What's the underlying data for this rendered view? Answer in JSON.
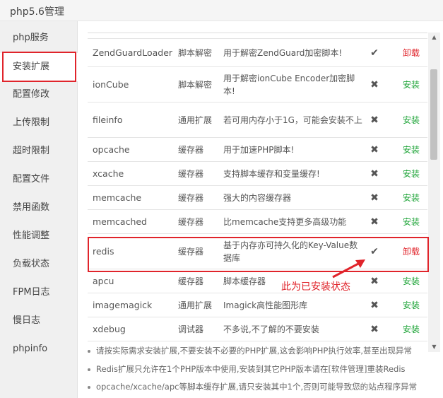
{
  "header": {
    "title": "php5.6管理"
  },
  "sidebar": {
    "items": [
      {
        "label": "php服务"
      },
      {
        "label": "安装扩展"
      },
      {
        "label": "配置修改"
      },
      {
        "label": "上传限制"
      },
      {
        "label": "超时限制"
      },
      {
        "label": "配置文件"
      },
      {
        "label": "禁用函数"
      },
      {
        "label": "性能调整"
      },
      {
        "label": "负载状态"
      },
      {
        "label": "FPM日志"
      },
      {
        "label": "慢日志"
      },
      {
        "label": "phpinfo"
      }
    ],
    "active_index": 1
  },
  "rows": [
    {
      "name": "",
      "type": "",
      "desc": "",
      "status": "",
      "op": ""
    },
    {
      "name": "ZendGuardLoader",
      "type": "脚本解密",
      "desc": "用于解密ZendGuard加密脚本!",
      "status": "check",
      "op": "卸载"
    },
    {
      "name": "ionCube",
      "type": "脚本解密",
      "desc": "用于解密ionCube Encoder加密脚本!",
      "status": "cross",
      "op": "安装"
    },
    {
      "name": "fileinfo",
      "type": "通用扩展",
      "desc": "若可用内存小于1G，可能会安装不上",
      "status": "cross",
      "op": "安装"
    },
    {
      "name": "opcache",
      "type": "缓存器",
      "desc": "用于加速PHP脚本!",
      "status": "cross",
      "op": "安装"
    },
    {
      "name": "xcache",
      "type": "缓存器",
      "desc": "支持脚本缓存和变量缓存!",
      "status": "cross",
      "op": "安装"
    },
    {
      "name": "memcache",
      "type": "缓存器",
      "desc": "强大的内容缓存器",
      "status": "cross",
      "op": "安装"
    },
    {
      "name": "memcached",
      "type": "缓存器",
      "desc": "比memcache支持更多高级功能",
      "status": "cross",
      "op": "安装"
    },
    {
      "name": "redis",
      "type": "缓存器",
      "desc": "基于内存亦可持久化的Key-Value数据库",
      "status": "check",
      "op": "卸载"
    },
    {
      "name": "apcu",
      "type": "缓存器",
      "desc": "脚本缓存器",
      "status": "cross",
      "op": "安装"
    },
    {
      "name": "imagemagick",
      "type": "通用扩展",
      "desc": "Imagick高性能图形库",
      "status": "cross",
      "op": "安装"
    },
    {
      "name": "xdebug",
      "type": "调试器",
      "desc": "不多说,不了解的不要安装",
      "status": "cross",
      "op": "安装"
    }
  ],
  "annotation": {
    "text": "此为已安装状态"
  },
  "notes": [
    "请按实际需求安装扩展,不要安装不必要的PHP扩展,这会影响PHP执行效率,甚至出现异常",
    "Redis扩展只允许在1个PHP版本中使用,安装到其它PHP版本请在[软件管理]重装Redis",
    "opcache/xcache/apc等脚本缓存扩展,请只安装其中1个,否则可能导致您的站点程序异常"
  ],
  "icons": {
    "check": "✔",
    "cross": "✖"
  },
  "colors": {
    "install": "#20a53a",
    "uninstall": "#e0242b",
    "highlight": "#e0242b"
  }
}
